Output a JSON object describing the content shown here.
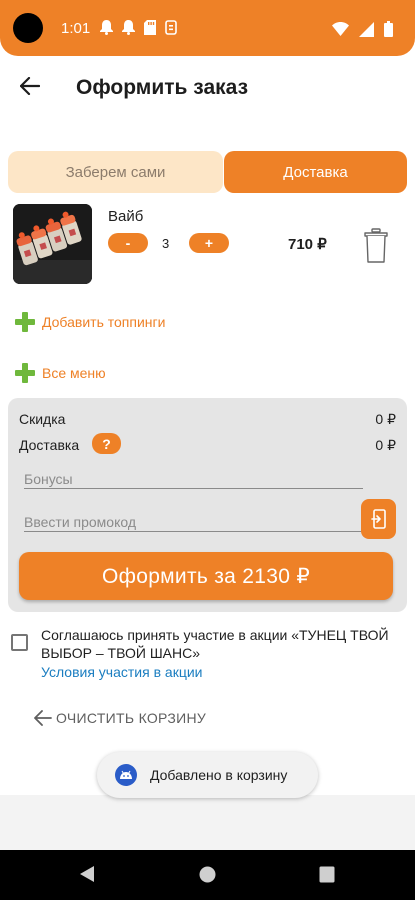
{
  "status_bar": {
    "time": "1:01",
    "left_icons": [
      "notification-bell-icon",
      "notification-bell-icon",
      "sd-card-icon",
      "debug-icon"
    ],
    "right_icons": [
      "wifi-icon",
      "signal-icon",
      "battery-icon"
    ],
    "color": "#ee8127"
  },
  "app_bar": {
    "title": "Оформить заказ",
    "back_icon": "arrow-left-icon"
  },
  "mode_tabs": {
    "pickup_label": "Заберем сами",
    "delivery_label": "Доставка",
    "selected": "delivery"
  },
  "cart": {
    "items": [
      {
        "name": "Вайб",
        "quantity": "3",
        "price": "710 ₽",
        "minus_label": "-",
        "plus_label": "+",
        "image": "sushi-roll-image"
      }
    ]
  },
  "links": {
    "add_toppings": "Добавить топпинги",
    "all_menu": "Все меню"
  },
  "summary": {
    "discount_label": "Скидка",
    "discount_value": "0 ₽",
    "delivery_label": "Доставка",
    "delivery_help": "?",
    "delivery_value": "0 ₽",
    "bonuses_placeholder": "Бонусы",
    "promo_placeholder": "Ввести промокод",
    "checkout_label": "Оформить за 2130 ₽"
  },
  "agreement": {
    "checked": false,
    "text": "Соглашаюсь принять участие в акции «ТУНЕЦ ТВОЙ ВЫБОР – ТВОЙ ШАНС»",
    "link": "Условия участия в акции"
  },
  "clear_cart_label": "ОЧИСТИТЬ КОРЗИНУ",
  "toast": {
    "text": "Добавлено в корзину",
    "icon": "android-icon"
  },
  "colors": {
    "accent": "#ee8127",
    "accent_light": "#fde6c7",
    "green": "#6fb83c",
    "link_blue": "#1a7dc0"
  }
}
